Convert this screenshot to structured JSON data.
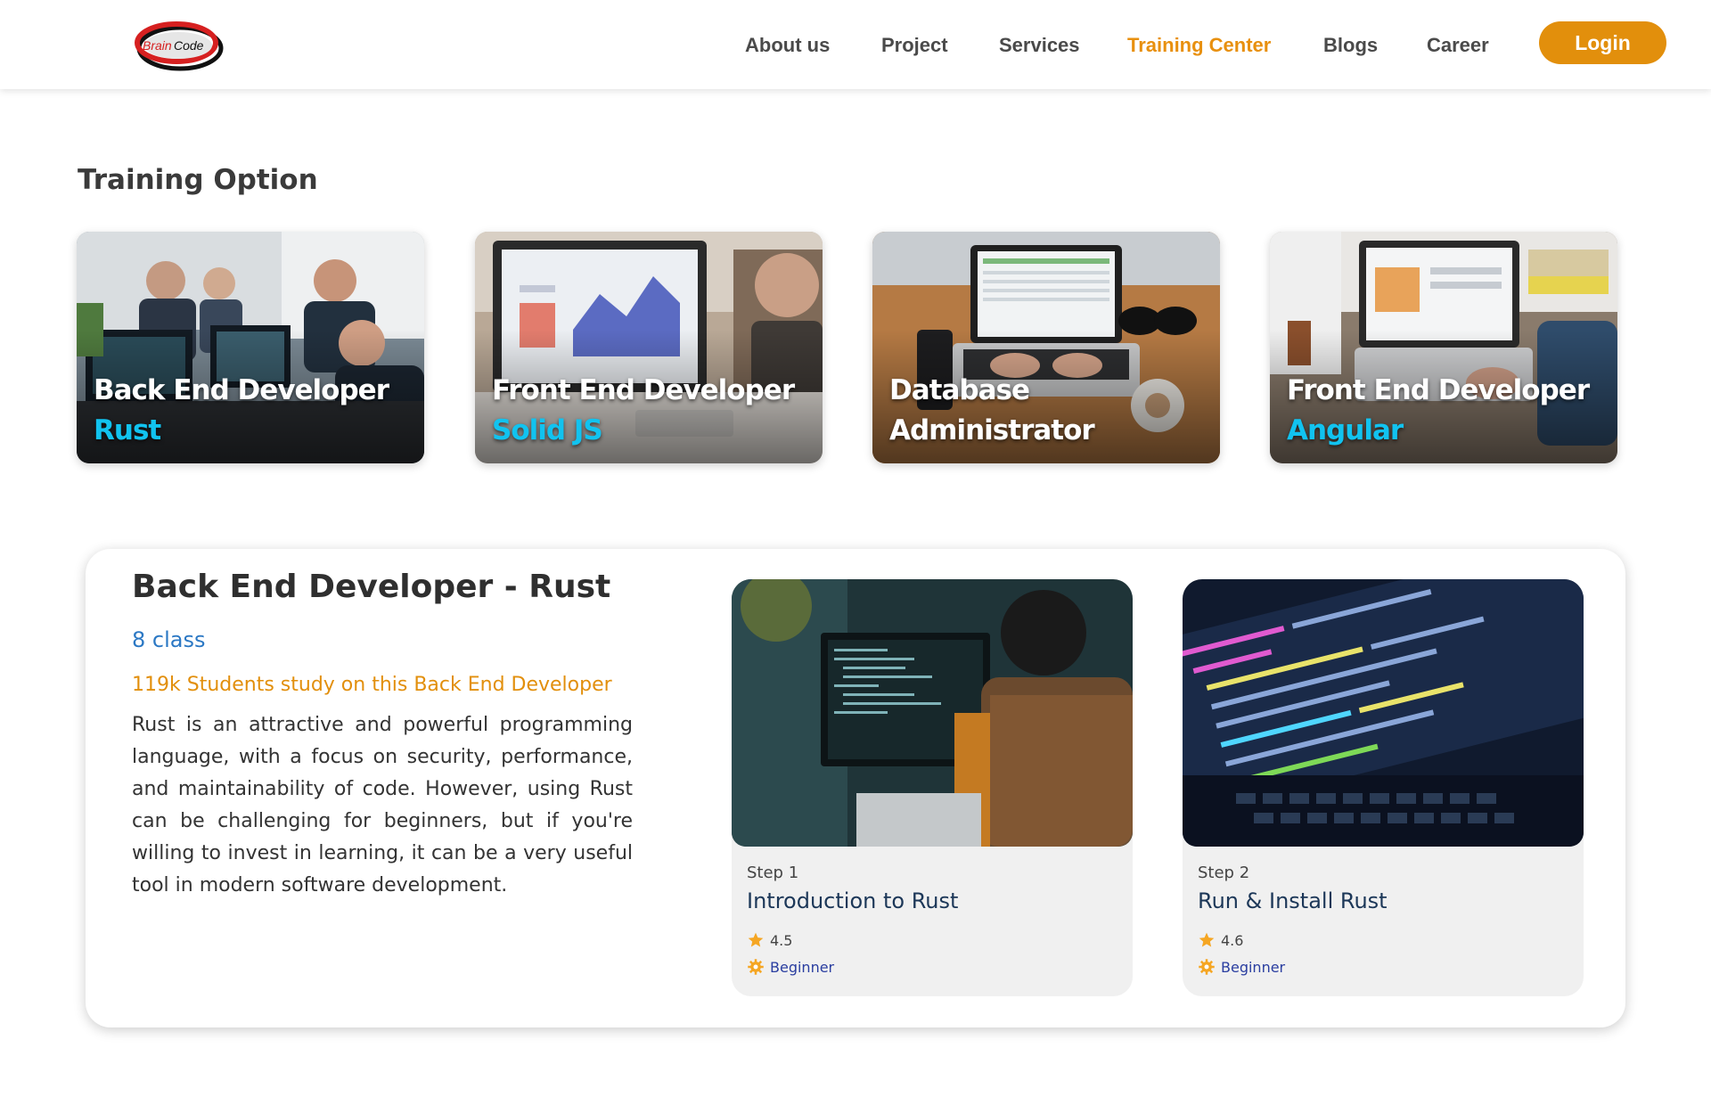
{
  "brand": {
    "logo_text": "BrainCode",
    "colors": {
      "accent": "#e28f0c",
      "active_nav": "#e8900f",
      "cyan": "#11c3f0",
      "link_blue": "#2b78c4",
      "star": "#f5a623"
    }
  },
  "nav": {
    "items": [
      {
        "label": "About us",
        "active": false
      },
      {
        "label": "Project",
        "active": false
      },
      {
        "label": "Services",
        "active": false
      },
      {
        "label": "Training Center",
        "active": true
      },
      {
        "label": "Blogs",
        "active": false
      },
      {
        "label": "Career",
        "active": false
      }
    ],
    "login_label": "Login"
  },
  "training": {
    "section_title": "Training Option",
    "options": [
      {
        "line1": "Back End Developer",
        "line2": "Rust"
      },
      {
        "line1": "Front End Developer",
        "line2": "Solid JS"
      },
      {
        "line1": "Database",
        "line2": "Administrator"
      },
      {
        "line1": "Front End Developer",
        "line2": "Angular"
      }
    ]
  },
  "detail": {
    "title": "Back End Developer - Rust",
    "class_count": "8 class",
    "students": "119k Students study on this Back End Developer",
    "description": "Rust is an attractive and powerful programming language, with a focus on security, performance, and maintainability of code. However, using Rust can be challenging for beginners, but if you're willing to invest in learning, it can be a very useful tool in modern software development.",
    "steps": [
      {
        "label": "Step 1",
        "name": "Introduction to Rust",
        "rating": "4.5",
        "level": "Beginner",
        "icons": [
          "star-icon",
          "gear-icon"
        ]
      },
      {
        "label": "Step 2",
        "name": "Run & Install Rust",
        "rating": "4.6",
        "level": "Beginner",
        "icons": [
          "star-icon",
          "gear-icon"
        ]
      }
    ]
  }
}
